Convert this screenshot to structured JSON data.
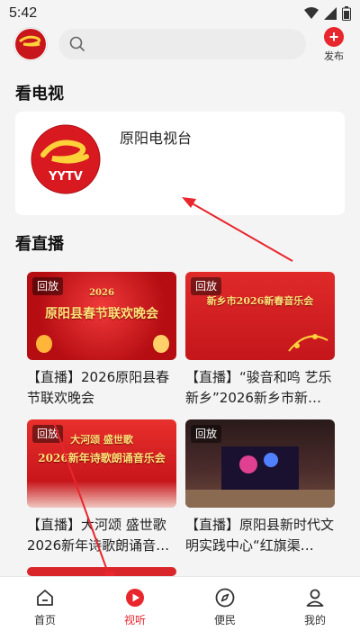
{
  "status_bar": {
    "time": "5:42"
  },
  "header": {
    "search_placeholder": "",
    "publish_label": "发布"
  },
  "tv_section": {
    "title": "看电视",
    "channels": [
      {
        "name": "原阳电视台",
        "logo_text": "YYTV"
      }
    ]
  },
  "live_section": {
    "title": "看直播",
    "items": [
      {
        "badge": "回放",
        "caption": "【直播】2026原阳县春节联欢晚会",
        "thumb_text": "原阳县春节联欢晚会",
        "thumb_year": "2026"
      },
      {
        "badge": "回放",
        "caption": "【直播】“骏音和鸣 艺乐新乡”2026新乡市新…",
        "thumb_text": "新乡市2026新春音乐会",
        "thumb_year": ""
      },
      {
        "badge": "回放",
        "caption": "【直播】大河颂 盛世歌 2026新年诗歌朗诵音…",
        "thumb_text": "2026新年诗歌朗诵音乐会",
        "thumb_year": "大河颂 盛世歌"
      },
      {
        "badge": "回放",
        "caption": "【直播】原阳县新时代文明实践中心“红旗渠…",
        "thumb_text": "",
        "thumb_year": ""
      }
    ]
  },
  "bottom_nav": {
    "items": [
      {
        "label": "首页",
        "icon": "home-icon"
      },
      {
        "label": "视听",
        "icon": "play-icon"
      },
      {
        "label": "便民",
        "icon": "compass-icon"
      },
      {
        "label": "我的",
        "icon": "user-icon"
      }
    ],
    "active_index": 1
  },
  "colors": {
    "accent": "#e8262d"
  }
}
